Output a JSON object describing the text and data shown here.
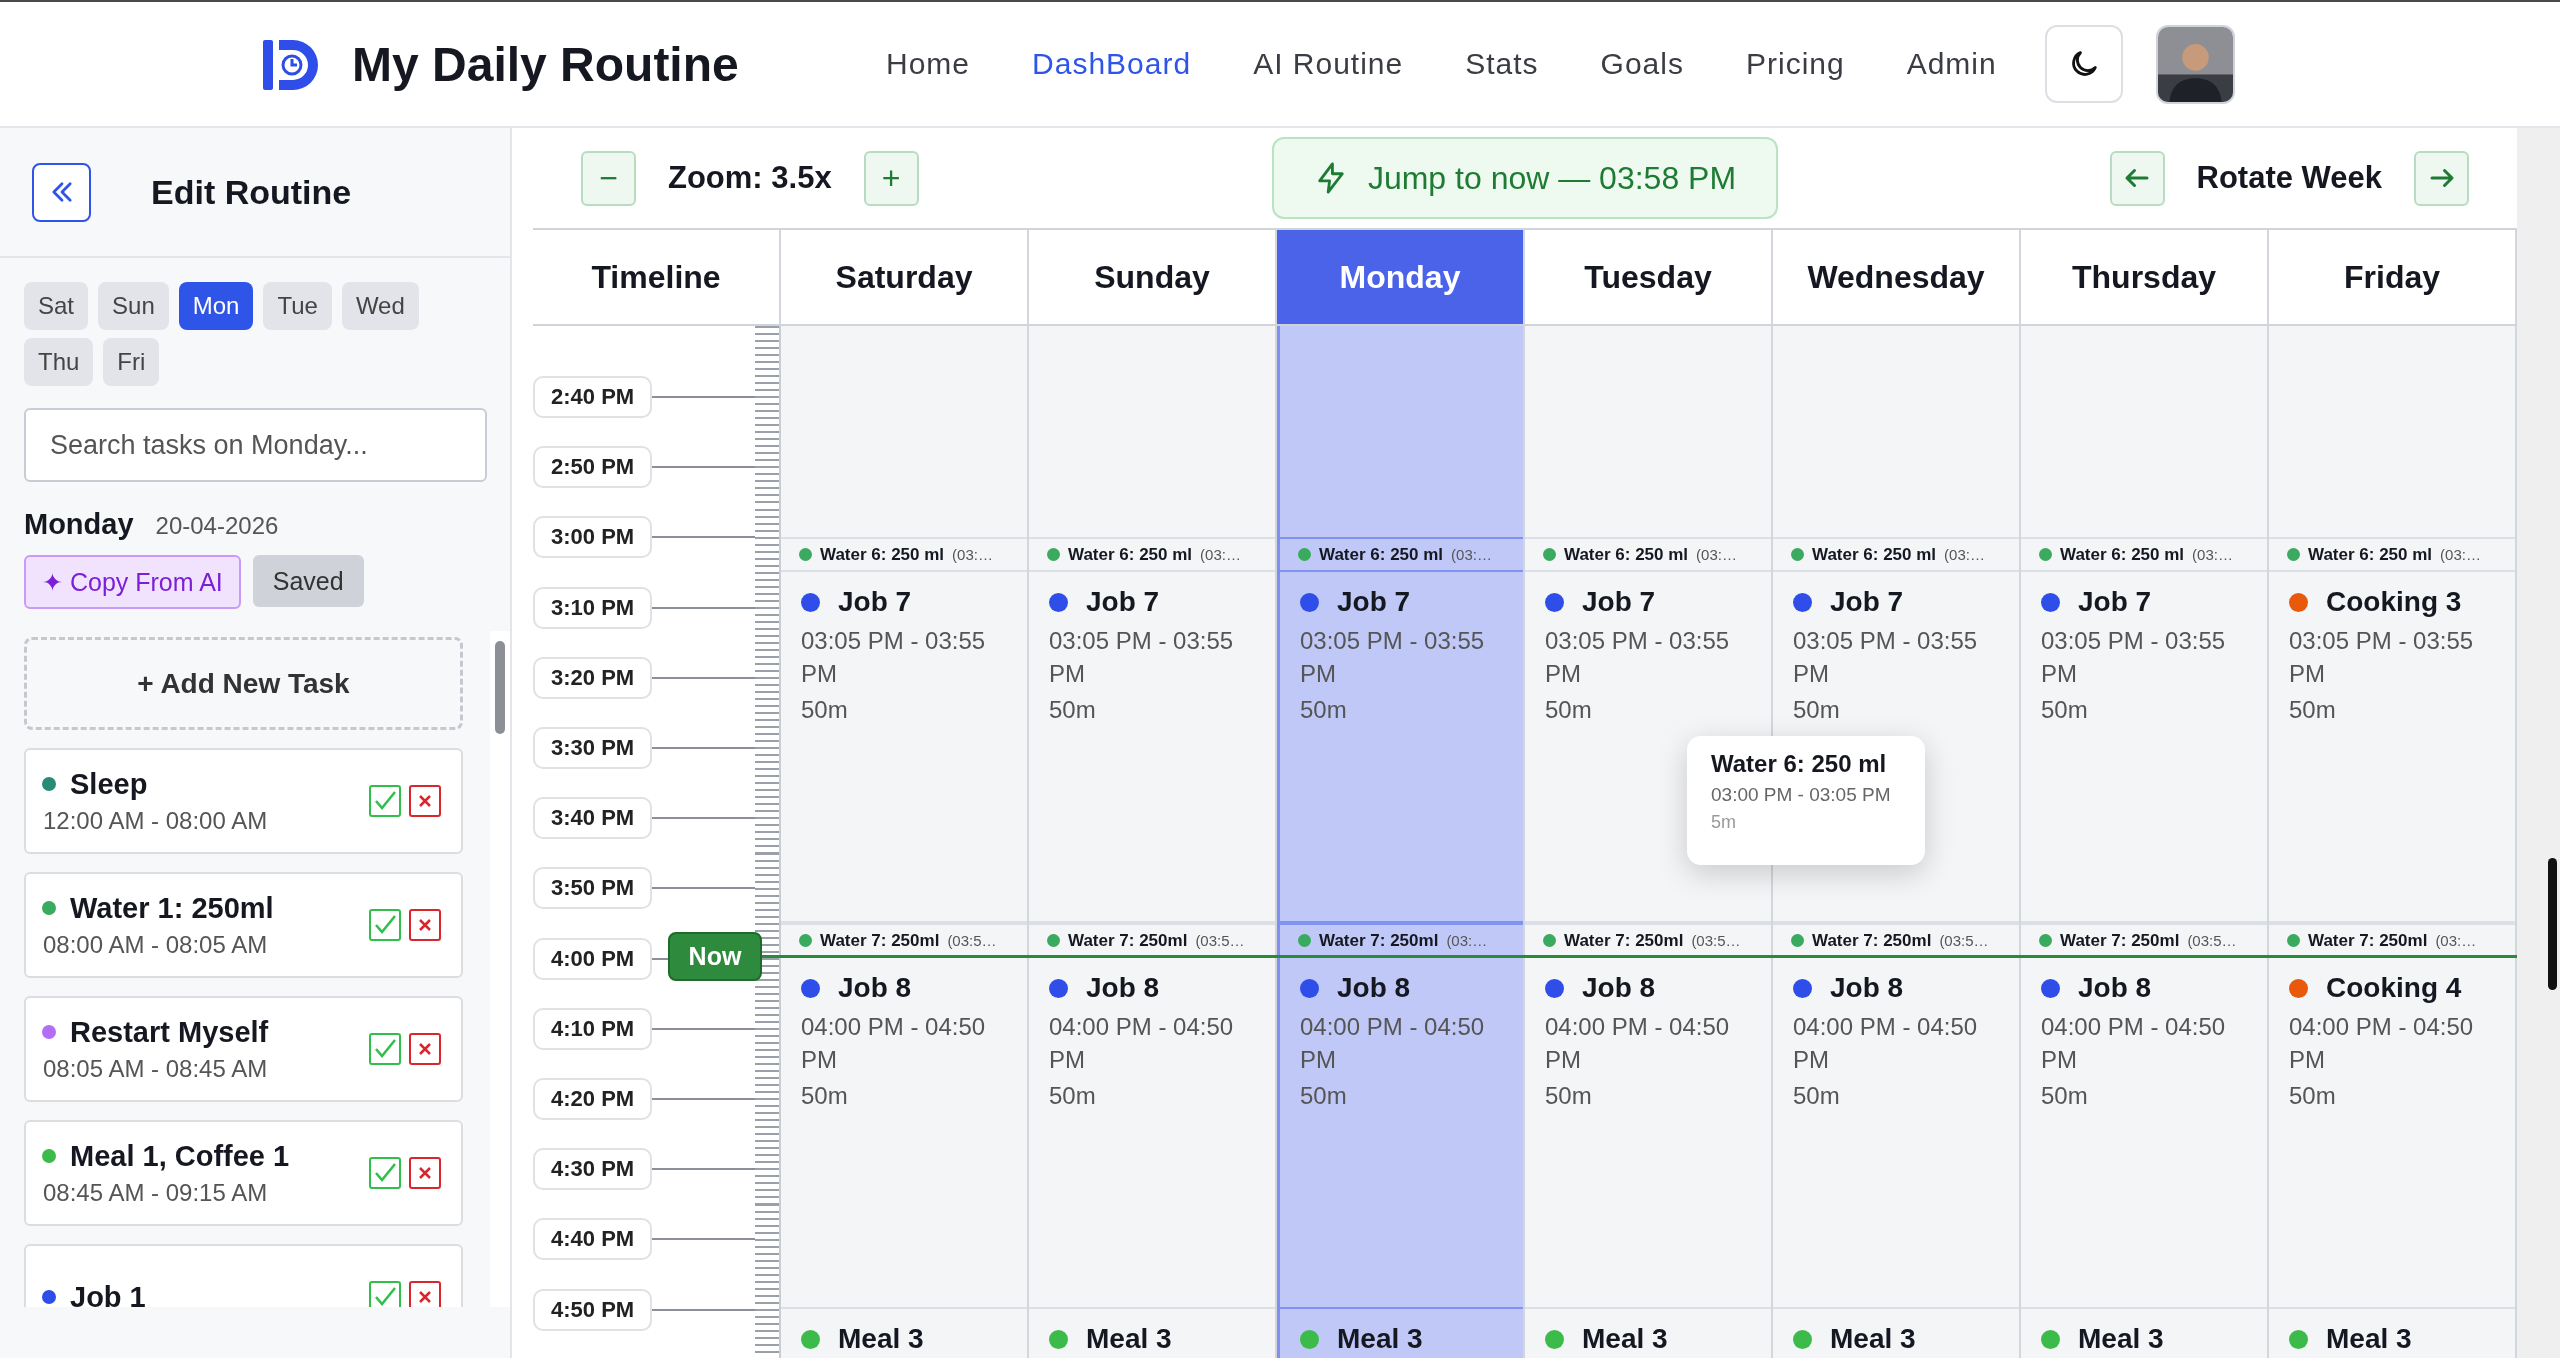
{
  "header": {
    "title": "My Daily Routine",
    "nav": [
      {
        "label": "Home",
        "selected": false
      },
      {
        "label": "DashBoard",
        "selected": true
      },
      {
        "label": "AI Routine",
        "selected": false
      },
      {
        "label": "Stats",
        "selected": false
      },
      {
        "label": "Goals",
        "selected": false
      },
      {
        "label": "Pricing",
        "selected": false
      },
      {
        "label": "Admin",
        "selected": false
      }
    ]
  },
  "sidebar": {
    "title": "Edit Routine",
    "days": [
      {
        "label": "Sat",
        "selected": false
      },
      {
        "label": "Sun",
        "selected": false
      },
      {
        "label": "Mon",
        "selected": true
      },
      {
        "label": "Tue",
        "selected": false
      },
      {
        "label": "Wed",
        "selected": false
      },
      {
        "label": "Thu",
        "selected": false
      },
      {
        "label": "Fri",
        "selected": false
      }
    ],
    "search": {
      "placeholder": "Search tasks on Monday..."
    },
    "day_name": "Monday",
    "date": "20-04-2026",
    "copy_button": "✦ Copy From AI",
    "status": "Saved",
    "add_button": "+ Add New Task",
    "tasks": [
      {
        "name": "Sleep",
        "time": "12:00 AM - 08:00 AM",
        "color": "#2a8a78"
      },
      {
        "name": "Water 1: 250ml",
        "time": "08:00 AM - 08:05 AM",
        "color": "#3aaa5e"
      },
      {
        "name": "Restart Myself",
        "time": "08:05 AM - 08:45 AM",
        "color": "#b46ef5"
      },
      {
        "name": "Meal 1, Coffee 1",
        "time": "08:45 AM - 09:15 AM",
        "color": "#3dbb4a"
      },
      {
        "name": "Job 1",
        "color": "#2f4de8"
      }
    ]
  },
  "toolbar": {
    "zoom_out": "−",
    "zoom_label": "Zoom: 3.5x",
    "zoom_in": "+",
    "jump_button": "Jump to now — 03:58 PM",
    "rotate_label": "Rotate Week"
  },
  "calendar": {
    "corner": "Timeline",
    "times": [
      "2:40 PM",
      "2:50 PM",
      "3:00 PM",
      "3:10 PM",
      "3:20 PM",
      "3:30 PM",
      "3:40 PM",
      "3:50 PM",
      "4:00 PM",
      "4:10 PM",
      "4:20 PM",
      "4:30 PM",
      "4:40 PM",
      "4:50 PM"
    ],
    "now_label": "Now",
    "days": [
      {
        "label": "Saturday",
        "selected": false,
        "events": [
          {
            "kind": "compact",
            "title": "Water 6: 250 ml",
            "time": "(03:…",
            "color": "#3aaa5e"
          },
          {
            "kind": "block",
            "title": "Job 7",
            "time": "03:05 PM - 03:55 PM",
            "duration": "50m",
            "color": "#2f4de8"
          },
          {
            "kind": "compact",
            "title": "Water 7: 250ml",
            "time": "(03:5…",
            "color": "#3aaa5e"
          },
          {
            "kind": "block",
            "title": "Job 8",
            "time": "04:00 PM - 04:50 PM",
            "duration": "50m",
            "color": "#2f4de8"
          },
          {
            "kind": "block",
            "title": "Meal 3",
            "color": "#3dbb4a"
          }
        ]
      },
      {
        "label": "Sunday",
        "selected": false,
        "events": [
          {
            "kind": "compact",
            "title": "Water 6: 250 ml",
            "time": "(03:…",
            "color": "#3aaa5e"
          },
          {
            "kind": "block",
            "title": "Job 7",
            "time": "03:05 PM - 03:55 PM",
            "duration": "50m",
            "color": "#2f4de8"
          },
          {
            "kind": "compact",
            "title": "Water 7: 250ml",
            "time": "(03:5…",
            "color": "#3aaa5e"
          },
          {
            "kind": "block",
            "title": "Job 8",
            "time": "04:00 PM - 04:50 PM",
            "duration": "50m",
            "color": "#2f4de8"
          },
          {
            "kind": "block",
            "title": "Meal 3",
            "color": "#3dbb4a"
          }
        ]
      },
      {
        "label": "Monday",
        "selected": true,
        "events": [
          {
            "kind": "compact",
            "title": "Water 6: 250 ml",
            "time": "(03:…",
            "color": "#3aaa5e"
          },
          {
            "kind": "block",
            "title": "Job 7",
            "time": "03:05 PM - 03:55 PM",
            "duration": "50m",
            "color": "#2f4de8"
          },
          {
            "kind": "compact",
            "title": "Water 7: 250ml",
            "time": "(03:…",
            "color": "#3aaa5e"
          },
          {
            "kind": "block",
            "title": "Job 8",
            "time": "04:00 PM - 04:50 PM",
            "duration": "50m",
            "color": "#2f4de8"
          },
          {
            "kind": "block",
            "title": "Meal 3",
            "color": "#3dbb4a"
          }
        ]
      },
      {
        "label": "Tuesday",
        "selected": false,
        "events": [
          {
            "kind": "compact",
            "title": "Water 6: 250 ml",
            "time": "(03:…",
            "color": "#3aaa5e"
          },
          {
            "kind": "block",
            "title": "Job 7",
            "time": "03:05 PM - 03:55 PM",
            "duration": "50m",
            "color": "#2f4de8"
          },
          {
            "kind": "compact",
            "title": "Water 7: 250ml",
            "time": "(03:5…",
            "color": "#3aaa5e"
          },
          {
            "kind": "block",
            "title": "Job 8",
            "time": "04:00 PM - 04:50 PM",
            "duration": "50m",
            "color": "#2f4de8"
          },
          {
            "kind": "block",
            "title": "Meal 3",
            "color": "#3dbb4a"
          }
        ]
      },
      {
        "label": "Wednesday",
        "selected": false,
        "events": [
          {
            "kind": "compact",
            "title": "Water 6: 250 ml",
            "time": "(03:…",
            "color": "#3aaa5e"
          },
          {
            "kind": "block",
            "title": "Job 7",
            "time": "03:05 PM - 03:55 PM",
            "duration": "50m",
            "color": "#2f4de8"
          },
          {
            "kind": "compact",
            "title": "Water 7: 250ml",
            "time": "(03:5…",
            "color": "#3aaa5e"
          },
          {
            "kind": "block",
            "title": "Job 8",
            "time": "04:00 PM - 04:50 PM",
            "duration": "50m",
            "color": "#2f4de8"
          },
          {
            "kind": "block",
            "title": "Meal 3",
            "color": "#3dbb4a"
          }
        ]
      },
      {
        "label": "Thursday",
        "selected": false,
        "events": [
          {
            "kind": "compact",
            "title": "Water 6: 250 ml",
            "time": "(03:…",
            "color": "#3aaa5e"
          },
          {
            "kind": "block",
            "title": "Job 7",
            "time": "03:05 PM - 03:55 PM",
            "duration": "50m",
            "color": "#2f4de8"
          },
          {
            "kind": "compact",
            "title": "Water 7: 250ml",
            "time": "(03:5…",
            "color": "#3aaa5e"
          },
          {
            "kind": "block",
            "title": "Job 8",
            "time": "04:00 PM - 04:50 PM",
            "duration": "50m",
            "color": "#2f4de8"
          },
          {
            "kind": "block",
            "title": "Meal 3",
            "color": "#3dbb4a"
          }
        ]
      },
      {
        "label": "Friday",
        "selected": false,
        "events": [
          {
            "kind": "compact",
            "title": "Water 6: 250 ml",
            "time": "(03:…",
            "color": "#3aaa5e"
          },
          {
            "kind": "block",
            "title": "Cooking 3",
            "time": "03:05 PM - 03:55 PM",
            "duration": "50m",
            "color": "#e8590c"
          },
          {
            "kind": "compact",
            "title": "Water 7: 250ml",
            "time": "(03:…",
            "color": "#3aaa5e"
          },
          {
            "kind": "block",
            "title": "Cooking 4",
            "time": "04:00 PM - 04:50 PM",
            "duration": "50m",
            "color": "#e8590c"
          },
          {
            "kind": "block",
            "title": "Meal 3",
            "color": "#3dbb4a"
          }
        ]
      }
    ],
    "tooltip": {
      "title": "Water 6: 250 ml",
      "time": "03:00 PM - 03:05 PM",
      "duration": "5m"
    }
  }
}
